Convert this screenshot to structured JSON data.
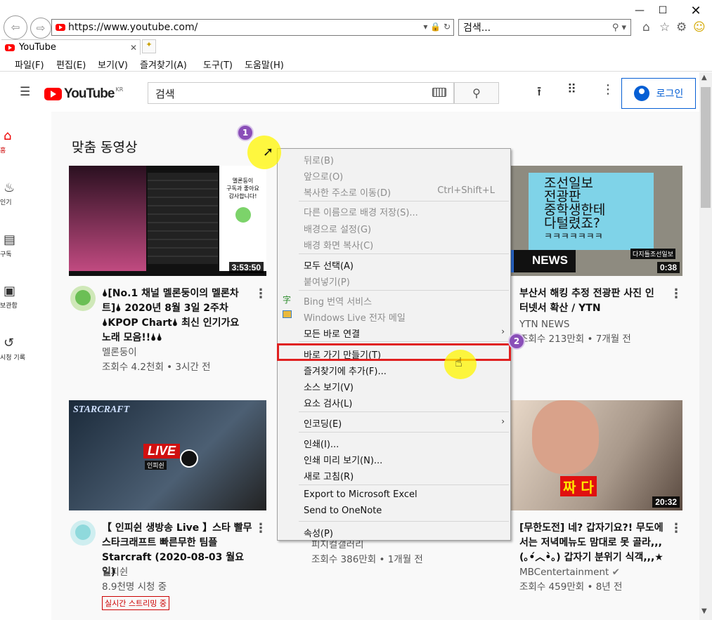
{
  "browser": {
    "url": "https://www.youtube.com/",
    "search_placeholder": "검색...",
    "tab_title": "YouTube",
    "menu": [
      "파일(F)",
      "편집(E)",
      "보기(V)",
      "즐겨찾기(A)",
      "도구(T)",
      "도움말(H)"
    ]
  },
  "youtube": {
    "logo": "YouTube",
    "region": "KR",
    "search_placeholder": "검색",
    "login": "로그인",
    "sidebar": [
      "홈",
      "인기",
      "구독",
      "보관함",
      "시청 기록"
    ],
    "section_title": "맞춤 동영상",
    "videos": [
      {
        "title_lines": [
          "🌢[No.1 채널 멜론둥이의 멜론차",
          "트]🌢 2020년 8월 3일 2주차",
          "🌢KPOP Chart🌢 최신 인기가요",
          "노래 모음!!🌢🌢"
        ],
        "channel": "멜론둥이",
        "stats": "조회수 4.2천회 • 3시간 전",
        "duration": "3:53:50"
      },
      {
        "title_lines": [
          "부산서 해킹 추정 전광판 사진 인",
          "터넷서 확산 / YTN"
        ],
        "channel": "YTN NEWS",
        "stats": "조회수 213만회 • 7개월 전",
        "duration": "0:38"
      },
      {
        "title_lines": [
          "【 인피쉰 생방송 Live 】스타 빨무",
          "스타크래프트 빠른무한 팀플",
          "Starcraft (2020-08-03 월요일)"
        ],
        "channel": "인피쉰",
        "stats": "8.9천명 시청 중",
        "badge": "실시간 스트리밍 중"
      },
      {
        "channel": "피지컬갤러리",
        "stats": "조회수 386만회 • 1개월 전"
      },
      {
        "title_lines": [
          "[무한도전] 네? 갑자기요?! 무도에",
          "서는 저녁메뉴도 맘대로 못 골라,,,",
          "(｡•́︿•̀｡) 갑자기 분위기 식객,,,★"
        ],
        "channel": "MBCentertainment",
        "stats": "조회수 459만회 • 8년 전",
        "duration": "20:32"
      }
    ],
    "thumb_text": {
      "ytn_board": [
        "조선일보",
        "전광판",
        "중학생한테",
        "다털렸죠?",
        "ㅋㅋㅋㅋㅋㅋㅋ"
      ],
      "ytn_caption": "다지틀조선일보",
      "news": "NEWS",
      "starcraft": "STARCRAFT",
      "live": "LIVE",
      "live_sub": "인피쉰",
      "melon_bubble": [
        "멜론둥이",
        "구독과 좋아요",
        "감사합니다!"
      ],
      "mbc": "짜 다"
    }
  },
  "context_menu": {
    "items": [
      {
        "label": "뒤로(B)",
        "disabled": true
      },
      {
        "label": "앞으로(O)",
        "disabled": true
      },
      {
        "label": "복사한 주소로 이동(D)",
        "shortcut": "Ctrl+Shift+L",
        "disabled": true
      },
      {
        "label": "다른 이름으로 배경 저장(S)...",
        "disabled": true
      },
      {
        "label": "배경으로 설정(G)",
        "disabled": true
      },
      {
        "label": "배경 화면 복사(C)",
        "disabled": true
      },
      {
        "label": "모두 선택(A)"
      },
      {
        "label": "붙여넣기(P)",
        "disabled": true
      },
      {
        "label": "Bing 번역 서비스",
        "disabled": true
      },
      {
        "label": "Windows Live 전자 메일",
        "disabled": true
      },
      {
        "label": "모든 바로 연결"
      },
      {
        "label": "바로 가기 만들기(T)"
      },
      {
        "label": "즐겨찾기에 추가(F)..."
      },
      {
        "label": "소스 보기(V)"
      },
      {
        "label": "요소 검사(L)"
      },
      {
        "label": "인코딩(E)"
      },
      {
        "label": "인쇄(I)..."
      },
      {
        "label": "인쇄 미리 보기(N)..."
      },
      {
        "label": "새로 고침(R)"
      },
      {
        "label": "Export to Microsoft Excel"
      },
      {
        "label": "Send to OneNote"
      },
      {
        "label": "속성(P)"
      }
    ]
  },
  "steps": [
    "1",
    "2"
  ],
  "colors": {
    "accent": "#065fd4",
    "highlight": "#e02020",
    "step": "#8a4fb8",
    "yt_red": "#ff0000"
  }
}
